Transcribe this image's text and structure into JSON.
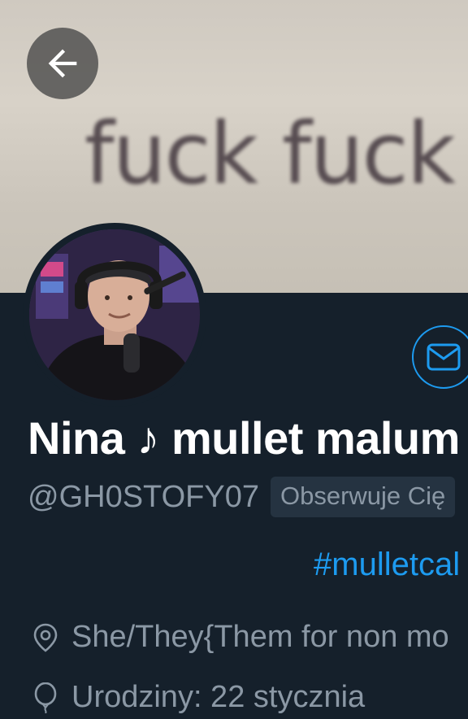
{
  "banner": {
    "text": "fuck fuck f"
  },
  "profile": {
    "display_name": "Nina ♪ mullet malum",
    "handle": "@GH0STOFY07",
    "follows_you_badge": "Obserwuje Cię"
  },
  "bio": {
    "link_text": "#mulletcal"
  },
  "meta": {
    "location": "She/They{Them for non mo",
    "birthday": "Urodziny: 22 stycznia"
  },
  "colors": {
    "background": "#15202b",
    "accent": "#1d9bf0",
    "secondary_text": "#8b98a5"
  },
  "icons": {
    "back": "arrow-left-icon",
    "message": "envelope-icon",
    "location": "location-pin-icon",
    "birthday": "balloon-icon"
  }
}
